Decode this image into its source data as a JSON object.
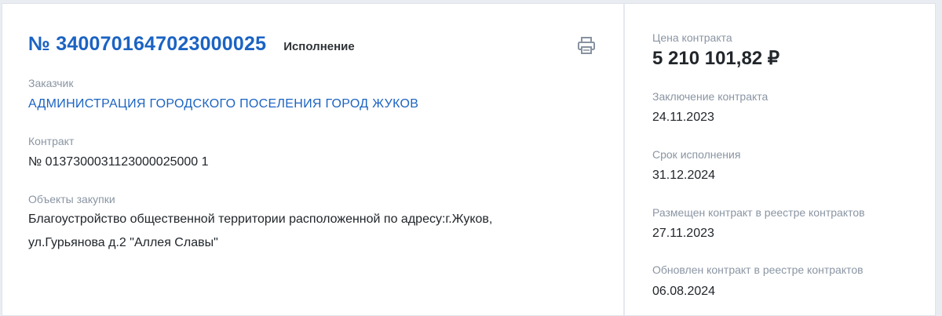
{
  "header": {
    "contract_number": "№ 3400701647023000025",
    "status": "Исполнение"
  },
  "customer": {
    "label": "Заказчик",
    "name": "АДМИНИСТРАЦИЯ ГОРОДСКОГО ПОСЕЛЕНИЯ ГОРОД ЖУКОВ"
  },
  "contract": {
    "label": "Контракт",
    "number": "№ 0137300031123000025000 1"
  },
  "purchase_objects": {
    "label": "Объекты закупки",
    "line1": "Благоустройство общественной территории расположенной по адресу:г.Жуков,",
    "line2": "ул.Гурьянова д.2 \"Аллея Славы\""
  },
  "sidebar": {
    "price_label": "Цена контракта",
    "price_value": "5 210 101,82 ₽",
    "conclusion_label": "Заключение контракта",
    "conclusion_date": "24.11.2023",
    "term_label": "Срок исполнения",
    "term_date": "31.12.2024",
    "placed_label": "Размещен контракт в реестре контрактов",
    "placed_date": "27.11.2023",
    "updated_label": "Обновлен контракт в реестре контрактов",
    "updated_date": "06.08.2024"
  },
  "icons": {
    "print": "print-icon"
  },
  "colors": {
    "link": "#1b63c3",
    "label": "#8a95a3",
    "text": "#21262b"
  }
}
